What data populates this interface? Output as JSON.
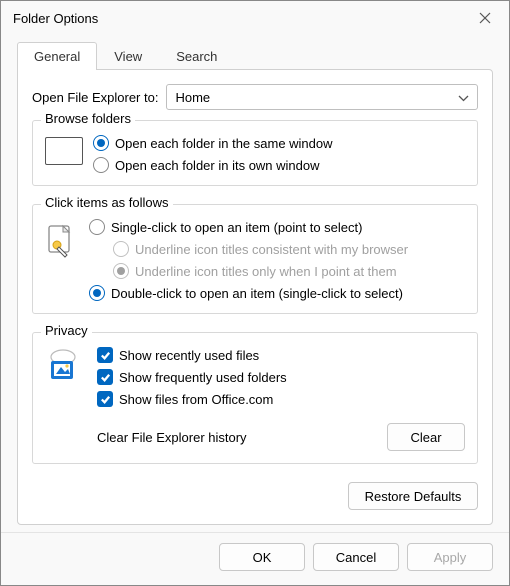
{
  "window": {
    "title": "Folder Options"
  },
  "tabs": {
    "general": "General",
    "view": "View",
    "search": "Search"
  },
  "openExplorer": {
    "label": "Open File Explorer to:",
    "value": "Home"
  },
  "browseFolders": {
    "legend": "Browse folders",
    "sameWindow": "Open each folder in the same window",
    "ownWindow": "Open each folder in its own window"
  },
  "clickItems": {
    "legend": "Click items as follows",
    "singleClick": "Single-click to open an item (point to select)",
    "underlineBrowser": "Underline icon titles consistent with my browser",
    "underlinePoint": "Underline icon titles only when I point at them",
    "doubleClick": "Double-click to open an item (single-click to select)"
  },
  "privacy": {
    "legend": "Privacy",
    "recentFiles": "Show recently used files",
    "frequentFolders": "Show frequently used folders",
    "officeFiles": "Show files from Office.com",
    "clearHistory": "Clear File Explorer history",
    "clearBtn": "Clear"
  },
  "buttons": {
    "restoreDefaults": "Restore Defaults",
    "ok": "OK",
    "cancel": "Cancel",
    "apply": "Apply"
  }
}
